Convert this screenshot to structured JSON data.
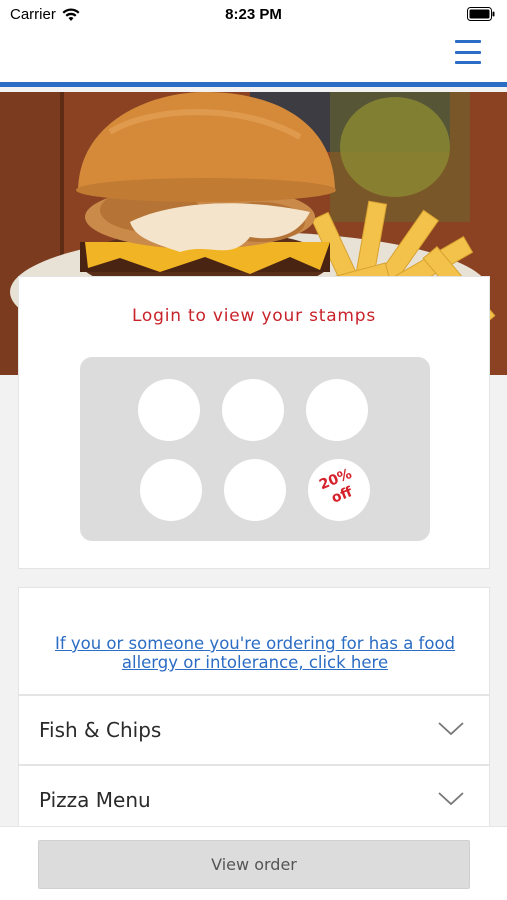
{
  "status_bar": {
    "carrier": "Carrier",
    "time": "8:23 PM"
  },
  "header": {
    "menu_icon": "hamburger-menu-icon",
    "accent_color": "#2b6cc4"
  },
  "stamps": {
    "title": "Login to view your stamps",
    "reward_line1": "20%",
    "reward_line2": "off",
    "title_color": "#c8222a"
  },
  "allergy": {
    "link_line1": "If you or someone you're ordering for has a food",
    "link_line2": "allergy or intolerance, click here"
  },
  "menu": {
    "items": [
      {
        "label": "Fish & Chips"
      },
      {
        "label": "Pizza Menu"
      }
    ]
  },
  "footer": {
    "view_order_label": "View order"
  }
}
